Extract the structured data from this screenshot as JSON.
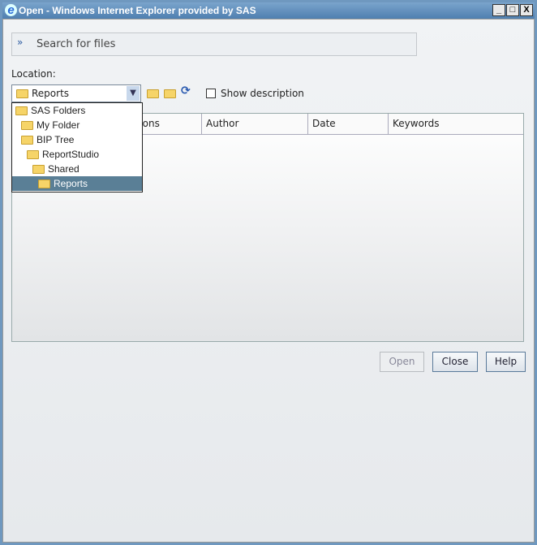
{
  "window": {
    "title": "Open - Windows Internet Explorer provided by SAS",
    "controls": [
      "_",
      "□",
      "X"
    ]
  },
  "search": {
    "label": "Search for files"
  },
  "location": {
    "label": "Location:",
    "selected": "Reports"
  },
  "toolbar": {
    "up_icon": "folder-up-icon",
    "new_icon": "new-folder-icon",
    "refresh_icon": "refresh-icon"
  },
  "show_description": {
    "label": "Show description",
    "checked": false
  },
  "table": {
    "columns": [
      "",
      "ctions",
      "Author",
      "Date",
      "Keywords"
    ]
  },
  "dropdown": {
    "items": [
      {
        "label": "SAS Folders",
        "level": 0
      },
      {
        "label": "My Folder",
        "level": 1
      },
      {
        "label": "BIP Tree",
        "level": 1
      },
      {
        "label": "ReportStudio",
        "level": 2
      },
      {
        "label": "Shared",
        "level": 3
      },
      {
        "label": "Reports",
        "level": 4,
        "selected": true
      }
    ]
  },
  "buttons": {
    "open": "Open",
    "close": "Close",
    "help": "Help"
  }
}
